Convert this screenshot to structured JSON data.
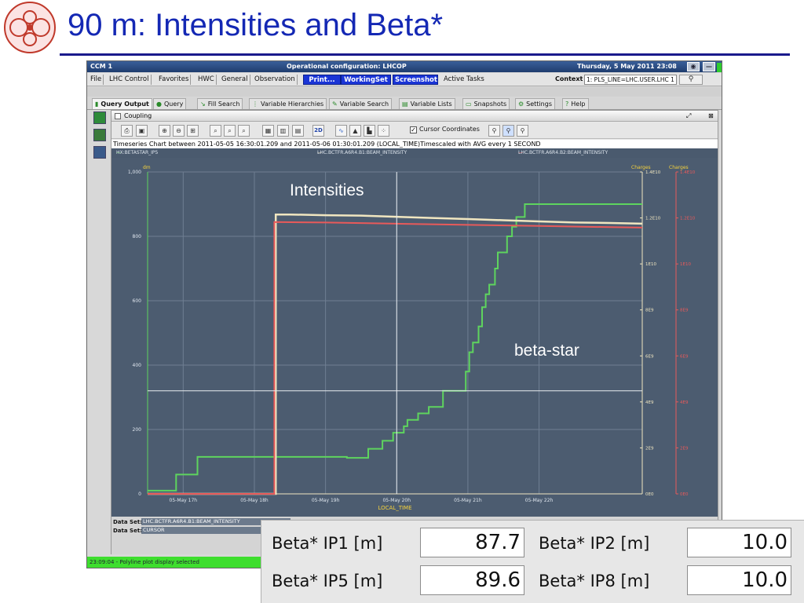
{
  "slide": {
    "title": "90 m: Intensities and Beta*",
    "annotations": {
      "intensities": "Intensities",
      "beta_star": "beta-star"
    }
  },
  "window": {
    "title_left": "CCM 1",
    "title_center": "Operational configuration: LHCOP",
    "title_right": "Thursday, 5 May 2011  23:08",
    "btn_min": "◉",
    "btn_close": "—"
  },
  "menubar": {
    "items": [
      "File",
      "LHC Control",
      "Favorites",
      "HWC",
      "General",
      "Observation"
    ],
    "buttons": [
      "Print...",
      "WorkingSet",
      "Screenshot"
    ],
    "active_tasks": "Active Tasks",
    "context_label": "Context",
    "context_value": "1: PLS_LINE=LHC.USER.LHC 1",
    "search_icon": "magnifier-icon"
  },
  "tabs": [
    "Query Output",
    "Query",
    "Fill Search",
    "Variable Hierarchies",
    "Variable Search",
    "Variable Lists",
    "Snapshots",
    "Settings",
    "Help"
  ],
  "panel": {
    "title": "Coupling",
    "cursor_coordinates_label": "Cursor Coordinates",
    "chart_header": "Timeseries Chart between 2011-05-05 16:30:01.209 and 2011-05-06 01:30:01.209 (LOCAL_TIME)Timescaled with AVG every 1 SECOND",
    "legend": [
      "HX:BETASTAR_IP5",
      "LHC.BCTFR.A6R4.B1:BEAM_INTENSITY",
      "LHC.BCTFR.A6R4.B2:BEAM_INTENSITY"
    ],
    "data_set_label_1": "Data Set:",
    "data_set_value_1": "LHC.BCTFR.A6R4.B1:BEAM_INTENSITY",
    "data_set_label_2": "Data Set:",
    "data_set_value_2": "CURSOR",
    "status": "23:09:04 - Polyline plot display selected"
  },
  "colors": {
    "beta_star": "#5ed45e",
    "b1": "#f0e6c0",
    "b2": "#e85a5a",
    "plot_bg": "#4c5c70"
  },
  "chart_data": {
    "type": "line",
    "xlabel": "LOCAL_TIME",
    "left_axis": {
      "label": "dm",
      "ylim": [
        0,
        1000
      ],
      "ticks": [
        "0",
        "200",
        "400",
        "600",
        "800",
        "1,000"
      ]
    },
    "right_axis_1": {
      "label": "Charges",
      "ylim": [
        0,
        14000000000.0
      ],
      "ticks": [
        "0E0",
        "2E9",
        "4E9",
        "6E9",
        "8E9",
        "1E10",
        "1.2E10",
        "1.4E10"
      ]
    },
    "right_axis_2": {
      "label": "Charges",
      "ylim": [
        0,
        14000000000.0
      ],
      "ticks": [
        "0E0",
        "2E9",
        "4E9",
        "6E9",
        "8E9",
        "1E10",
        "1.2E10",
        "1.4E10"
      ]
    },
    "x_ticks": [
      "05-May 17h",
      "05-May 18h",
      "05-May 19h",
      "05-May 20h",
      "05-May 21h",
      "05-May 22h"
    ],
    "x_tick_values": [
      17,
      18,
      19,
      20,
      21,
      22
    ],
    "xlim": [
      16.5,
      23.45
    ],
    "series": [
      {
        "name": "HX:BETASTAR_IP5",
        "axis": "left",
        "color": "#5ed45e",
        "x": [
          16.5,
          16.9,
          16.9,
          17.2,
          17.2,
          19.3,
          19.3,
          19.6,
          19.6,
          19.8,
          19.8,
          19.95,
          19.95,
          20.1,
          20.1,
          20.15,
          20.15,
          20.3,
          20.3,
          20.45,
          20.45,
          20.65,
          20.65,
          20.97,
          20.97,
          21.02,
          21.02,
          21.07,
          21.07,
          21.15,
          21.15,
          21.2,
          21.2,
          21.25,
          21.25,
          21.3,
          21.3,
          21.38,
          21.38,
          21.42,
          21.42,
          21.55,
          21.55,
          21.62,
          21.62,
          21.68,
          21.68,
          21.8,
          21.8,
          23.45
        ],
        "y": [
          10,
          10,
          60,
          60,
          115,
          115,
          112,
          112,
          140,
          140,
          165,
          165,
          190,
          190,
          210,
          210,
          230,
          230,
          250,
          250,
          270,
          270,
          320,
          320,
          380,
          380,
          440,
          440,
          470,
          470,
          520,
          520,
          580,
          580,
          620,
          620,
          650,
          650,
          700,
          700,
          750,
          750,
          800,
          800,
          830,
          830,
          860,
          860,
          900,
          900
        ]
      },
      {
        "name": "LHC.BCTFR.A6R4.B1:BEAM_INTENSITY",
        "axis": "right_1",
        "color": "#f0e6c0",
        "x": [
          16.5,
          18.3,
          18.3,
          18.5,
          19.0,
          19.5,
          20.0,
          20.5,
          21.0,
          21.5,
          22.0,
          22.5,
          23.0,
          23.45
        ],
        "y": [
          0,
          0,
          12150000000.0,
          12150000000.0,
          12120000000.0,
          12100000000.0,
          12050000000.0,
          12000000000.0,
          11950000000.0,
          11900000000.0,
          11850000000.0,
          11800000000.0,
          11780000000.0,
          11750000000.0
        ]
      },
      {
        "name": "LHC.BCTFR.A6R4.B2:BEAM_INTENSITY",
        "axis": "right_1",
        "color": "#e85a5a",
        "x": [
          16.5,
          18.28,
          18.28,
          19.0,
          20.0,
          21.0,
          22.0,
          23.0,
          23.45
        ],
        "y": [
          0,
          0,
          11820000000.0,
          11800000000.0,
          11750000000.0,
          11700000000.0,
          11650000000.0,
          11600000000.0,
          11580000000.0
        ]
      }
    ],
    "cursor": {
      "x": 20.0,
      "y": 320
    }
  },
  "beta_table": {
    "rows": [
      {
        "label_a": "Beta* IP1 [m]",
        "value_a": "87.7",
        "label_b": "Beta* IP2 [m]",
        "value_b": "10.0"
      },
      {
        "label_a": "Beta* IP5 [m]",
        "value_a": "89.6",
        "label_b": "Beta* IP8 [m]",
        "value_b": "10.0"
      }
    ]
  }
}
